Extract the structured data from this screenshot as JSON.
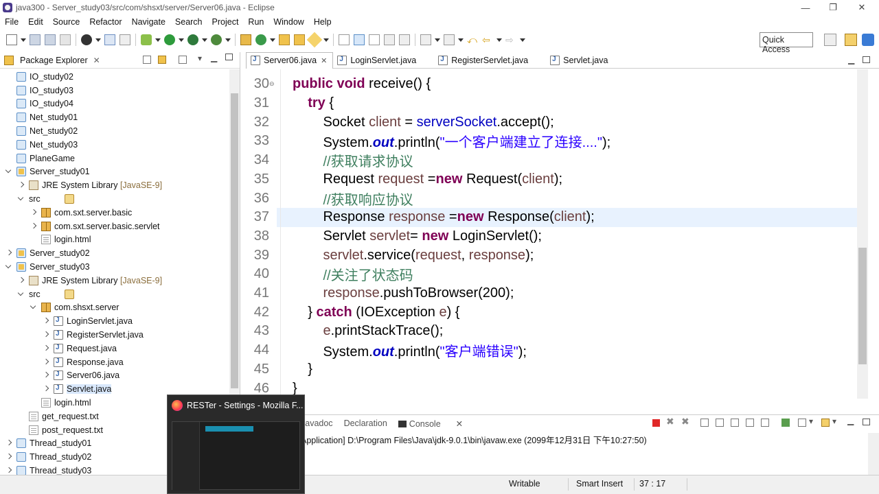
{
  "window": {
    "title": "java300 - Server_study03/src/com/shsxt/server/Server06.java - Eclipse"
  },
  "menu": [
    "File",
    "Edit",
    "Source",
    "Refactor",
    "Navigate",
    "Search",
    "Project",
    "Run",
    "Window",
    "Help"
  ],
  "quick_access": "Quick Access",
  "package_explorer": {
    "title": "Package Explorer",
    "items": [
      {
        "label": "IO_study02"
      },
      {
        "label": "IO_study03"
      },
      {
        "label": "IO_study04"
      },
      {
        "label": "Net_study01"
      },
      {
        "label": "Net_study02"
      },
      {
        "label": "Net_study03"
      },
      {
        "label": "PlaneGame"
      },
      {
        "label": "Server_study01"
      },
      {
        "label": "JRE System Library",
        "suffix": "[JavaSE-9]"
      },
      {
        "label": "src"
      },
      {
        "label": "com.sxt.server.basic"
      },
      {
        "label": "com.sxt.server.basic.servlet"
      },
      {
        "label": "login.html"
      },
      {
        "label": "Server_study02"
      },
      {
        "label": "Server_study03"
      },
      {
        "label": "JRE System Library",
        "suffix": "[JavaSE-9]"
      },
      {
        "label": "src"
      },
      {
        "label": "com.shsxt.server"
      },
      {
        "label": "LoginServlet.java"
      },
      {
        "label": "RegisterServlet.java"
      },
      {
        "label": "Request.java"
      },
      {
        "label": "Response.java"
      },
      {
        "label": "Server06.java"
      },
      {
        "label": "Servlet.java"
      },
      {
        "label": "login.html"
      },
      {
        "label": "get_request.txt"
      },
      {
        "label": "post_request.txt"
      },
      {
        "label": "Thread_study01"
      },
      {
        "label": "Thread_study02"
      },
      {
        "label": "Thread_study03"
      }
    ]
  },
  "editor": {
    "tabs": [
      "Server06.java",
      "LoginServlet.java",
      "RegisterServlet.java",
      "Servlet.java"
    ],
    "lines": [
      {
        "n": "30",
        "t": "    public void receive() {"
      },
      {
        "n": "31",
        "t": "        try {"
      },
      {
        "n": "32",
        "t": "            Socket client = serverSocket.accept();"
      },
      {
        "n": "33",
        "t": "            System.out.println(\"一个客户端建立了连接....\");"
      },
      {
        "n": "34",
        "t": "            //获取请求协议"
      },
      {
        "n": "35",
        "t": "            Request request =new Request(client);"
      },
      {
        "n": "36",
        "t": "            //获取响应协议"
      },
      {
        "n": "37",
        "t": "            Response response =new Response(client);"
      },
      {
        "n": "38",
        "t": "            Servlet servlet= new LoginServlet();"
      },
      {
        "n": "39",
        "t": "            servlet.service(request, response);"
      },
      {
        "n": "40",
        "t": "            //关注了状态码"
      },
      {
        "n": "41",
        "t": "            response.pushToBrowser(200);"
      },
      {
        "n": "42",
        "t": "        } catch (IOException e) {"
      },
      {
        "n": "43",
        "t": "            e.printStackTrace();"
      },
      {
        "n": "44",
        "t": "            System.out.println(\"客户端错误\");"
      },
      {
        "n": "45",
        "t": "        }"
      },
      {
        "n": "46",
        "t": "    }"
      }
    ]
  },
  "console": {
    "tabs": [
      "Javadoc",
      "Declaration",
      "Console"
    ],
    "text": "Application] D:\\Program Files\\Java\\jdk-9.0.1\\bin\\javaw.exe (2099年12月31日 下午10:27:50)"
  },
  "status": {
    "writable": "Writable",
    "insert": "Smart Insert",
    "position": "37 : 17"
  },
  "taskbar_preview": {
    "title": "RESTer - Settings - Mozilla F..."
  }
}
